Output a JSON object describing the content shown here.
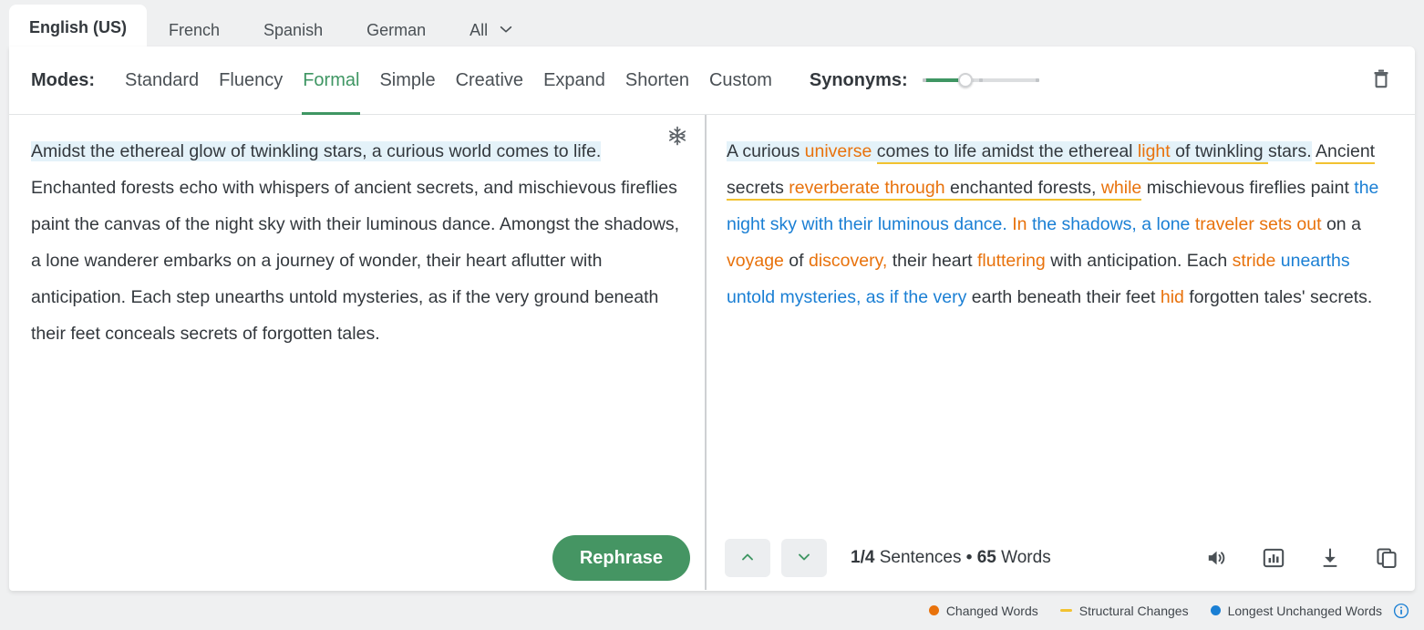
{
  "colors": {
    "accent_green": "#3f9663",
    "changed_words": "#e8720c",
    "structural_changes": "#f2c230",
    "unchanged_words": "#1a7fd4",
    "sentence_highlight": "#e4f2f9"
  },
  "language_tabs": [
    {
      "label": "English (US)",
      "active": true
    },
    {
      "label": "French",
      "active": false
    },
    {
      "label": "Spanish",
      "active": false
    },
    {
      "label": "German",
      "active": false
    },
    {
      "label": "All",
      "active": false,
      "has_chevron": true
    }
  ],
  "modes": {
    "label": "Modes:",
    "items": [
      {
        "label": "Standard",
        "active": false
      },
      {
        "label": "Fluency",
        "active": false
      },
      {
        "label": "Formal",
        "active": true
      },
      {
        "label": "Simple",
        "active": false
      },
      {
        "label": "Creative",
        "active": false
      },
      {
        "label": "Expand",
        "active": false
      },
      {
        "label": "Shorten",
        "active": false
      },
      {
        "label": "Custom",
        "active": false
      }
    ],
    "synonyms_label": "Synonyms:",
    "synonyms_value": 37,
    "trash_icon": "trash-icon"
  },
  "left_pane": {
    "freeze_icon": "snowflake-icon",
    "sentences": [
      {
        "text": "Amidst the ethereal glow of twinkling stars, a curious world comes to life.",
        "highlighted": true
      },
      {
        "text": "Enchanted forests echo with whispers of ancient secrets, and mischievous fireflies paint the canvas of the night sky with their luminous dance.",
        "highlighted": false
      },
      {
        "text": "Amongst the shadows, a lone wanderer embarks on a journey of wonder, their heart aflutter with anticipation.",
        "highlighted": false
      },
      {
        "text": "Each step unearths untold mysteries, as if the very ground beneath their feet conceals secrets of forgotten tales.",
        "highlighted": false
      }
    ],
    "rephrase_label": "Rephrase"
  },
  "right_pane": {
    "segments": [
      {
        "text": "A curious ",
        "style": "plain",
        "highlight": true
      },
      {
        "text": "universe",
        "style": "changed",
        "highlight": true
      },
      {
        "text": " ",
        "style": "plain",
        "highlight": true
      },
      {
        "text": "comes to life amidst the ethereal ",
        "style": "structural",
        "highlight": true
      },
      {
        "text": "light",
        "style": "changed-structural",
        "highlight": true
      },
      {
        "text": " of twinkling ",
        "style": "structural",
        "highlight": true
      },
      {
        "text": "stars.",
        "style": "plain",
        "highlight": true
      },
      {
        "text": " ",
        "style": "plain",
        "highlight": false
      },
      {
        "text": "Ancient secrets ",
        "style": "structural",
        "highlight": false
      },
      {
        "text": "reverberate through",
        "style": "changed-structural",
        "highlight": false
      },
      {
        "text": " enchanted forests, ",
        "style": "structural",
        "highlight": false
      },
      {
        "text": "while",
        "style": "changed-structural",
        "highlight": false
      },
      {
        "text": " mischievous fireflies paint ",
        "style": "plain",
        "highlight": false
      },
      {
        "text": "the night sky with their luminous dance.",
        "style": "unchanged",
        "highlight": false
      },
      {
        "text": " ",
        "style": "plain",
        "highlight": false
      },
      {
        "text": "In",
        "style": "changed",
        "highlight": false
      },
      {
        "text": " ",
        "style": "plain",
        "highlight": false
      },
      {
        "text": "the shadows, a lone",
        "style": "unchanged",
        "highlight": false
      },
      {
        "text": " ",
        "style": "plain",
        "highlight": false
      },
      {
        "text": "traveler sets out",
        "style": "changed",
        "highlight": false
      },
      {
        "text": " on a ",
        "style": "plain",
        "highlight": false
      },
      {
        "text": "voyage",
        "style": "changed",
        "highlight": false
      },
      {
        "text": " of ",
        "style": "plain",
        "highlight": false
      },
      {
        "text": "discovery,",
        "style": "changed",
        "highlight": false
      },
      {
        "text": " their heart ",
        "style": "plain",
        "highlight": false
      },
      {
        "text": "fluttering",
        "style": "changed",
        "highlight": false
      },
      {
        "text": " with anticipation. Each ",
        "style": "plain",
        "highlight": false
      },
      {
        "text": "stride",
        "style": "changed",
        "highlight": false
      },
      {
        "text": " ",
        "style": "plain",
        "highlight": false
      },
      {
        "text": "unearths untold mysteries, as if the very",
        "style": "unchanged",
        "highlight": false
      },
      {
        "text": " earth beneath their feet ",
        "style": "plain",
        "highlight": false
      },
      {
        "text": "hid",
        "style": "changed",
        "highlight": false
      },
      {
        "text": " forgotten tales' secrets.",
        "style": "plain",
        "highlight": false
      }
    ],
    "prev_icon": "chevron-up-icon",
    "next_icon": "chevron-down-icon",
    "sentence_count": "1/4",
    "sentence_word": "Sentences",
    "separator": "•",
    "word_count": "65",
    "word_word": "Words",
    "tools": [
      {
        "name": "speaker-icon"
      },
      {
        "name": "bar-chart-icon"
      },
      {
        "name": "download-icon"
      },
      {
        "name": "copy-icon"
      }
    ]
  },
  "legend": {
    "items": [
      {
        "label": "Changed Words",
        "marker": "dot",
        "color": "#e8720c"
      },
      {
        "label": "Structural Changes",
        "marker": "dash",
        "color": "#f2c230"
      },
      {
        "label": "Longest Unchanged Words",
        "marker": "dot",
        "color": "#1a7fd4"
      }
    ],
    "info_icon": "info-icon"
  }
}
